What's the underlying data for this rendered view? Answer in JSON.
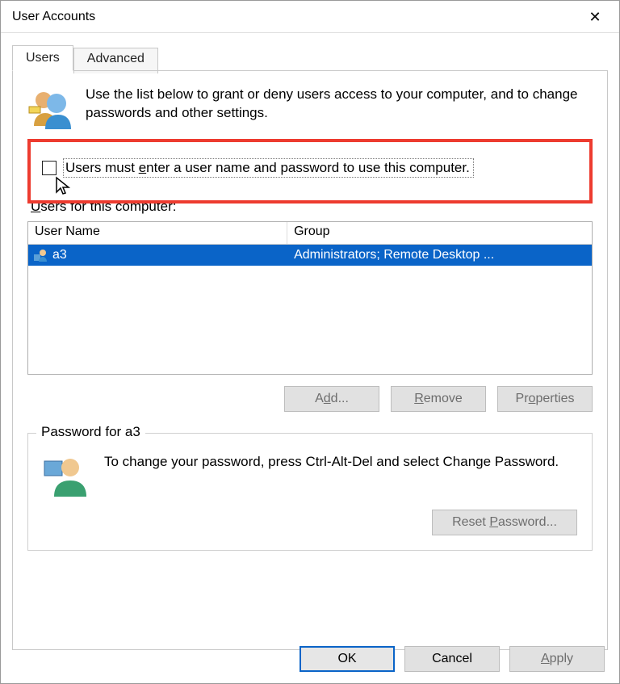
{
  "window": {
    "title": "User Accounts"
  },
  "tabs": {
    "users": "Users",
    "advanced": "Advanced"
  },
  "intro": "Use the list below to grant or deny users access to your computer, and to change passwords and other settings.",
  "checkbox": {
    "label_prefix": "Users must ",
    "label_ul": "e",
    "label_suffix": "nter a user name and password to use this computer.",
    "checked": false
  },
  "users_section": {
    "label_ul": "U",
    "label_suffix": "sers for this computer:"
  },
  "columns": {
    "user_name": "User Name",
    "group": "Group"
  },
  "rows": [
    {
      "name": "a3",
      "group": "Administrators; Remote Desktop ..."
    }
  ],
  "buttons": {
    "add_prefix": "A",
    "add_ul": "d",
    "add_suffix": "d...",
    "remove_ul": "R",
    "remove_suffix": "emove",
    "props_prefix": "Pr",
    "props_ul": "o",
    "props_suffix": "perties"
  },
  "password_section": {
    "legend": "Password for a3",
    "text": "To change your password, press Ctrl-Alt-Del and select Change Password.",
    "reset_prefix": "Reset ",
    "reset_ul": "P",
    "reset_suffix": "assword..."
  },
  "footer": {
    "ok": "OK",
    "cancel": "Cancel",
    "apply_ul": "A",
    "apply_suffix": "pply"
  }
}
